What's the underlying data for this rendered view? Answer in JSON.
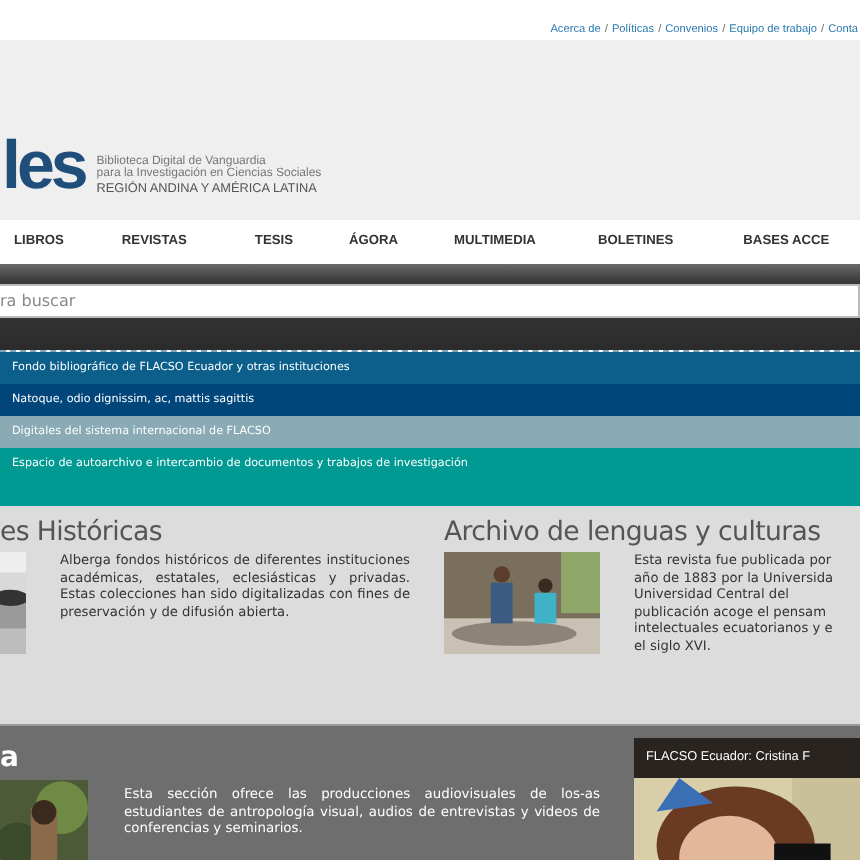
{
  "top_links": [
    {
      "label": "Acerca de"
    },
    {
      "separator": "/",
      "label": "Políticas"
    },
    {
      "separator": "/",
      "label": "Convenios"
    },
    {
      "separator": "/",
      "label": "Equipo de trabajo"
    },
    {
      "separator": "/",
      "label": "Conta"
    }
  ],
  "header": {
    "logo_text": "les",
    "tagline": [
      "Biblioteca Digital de Vanguardia",
      "para la Investigación en Ciencias Sociales",
      "REGIÓN ANDINA Y AMÉRICA LATINA"
    ]
  },
  "nav": [
    "LIBROS",
    "REVISTAS",
    "TESIS",
    "ÁGORA",
    "MULTIMEDIA",
    "BOLETINES",
    "BASES ACCE"
  ],
  "search": {
    "placeholder": "ra buscar"
  },
  "collections": [
    {
      "label": "Fondo bibliográfico de FLACSO Ecuador y otras instituciones",
      "color": "#0b5f8a"
    },
    {
      "label": "Natoque, odio dignissim, ac, mattis sagittis",
      "color": "#00467a"
    },
    {
      "label": "Digitales del sistema internacional de FLACSO",
      "color": "#8aaab5"
    },
    {
      "label": "Espacio de autoarchivo e intercambio de documentos y trabajos de investigación",
      "color": "#009a92"
    }
  ],
  "features": [
    {
      "title": "es Históricas",
      "picture": {
        "kind": "picture"
      },
      "text_lines": [
        "Alberga fondos históricos de diferentes instituciones académicas, estatales, eclesiásticas y privadas. Estas colecciones han sido digitalizadas con fines de preservación y de difusión abierta."
      ]
    },
    {
      "title": "Archivo de lenguas y culturas",
      "picture": {
        "kind": "picture"
      },
      "text_lines": [
        "Esta revista fue publicada por",
        "año de 1883 por la Universida",
        "Universidad Central del",
        "publicación acoge el pensam",
        "intelectuales ecuatorianos y e",
        "el siglo XVI."
      ]
    }
  ],
  "multimedia": {
    "title": "a",
    "picture": {
      "kind": "picture"
    },
    "text": "Esta sección ofrece las producciones audiovisuales de los-as estudiantes de antropología visual, audios de entrevistas y videos de conferencias y seminarios.",
    "video": {
      "title": "FLACSO Ecuador: Cristina F",
      "picture": {
        "kind": "picture"
      }
    }
  }
}
